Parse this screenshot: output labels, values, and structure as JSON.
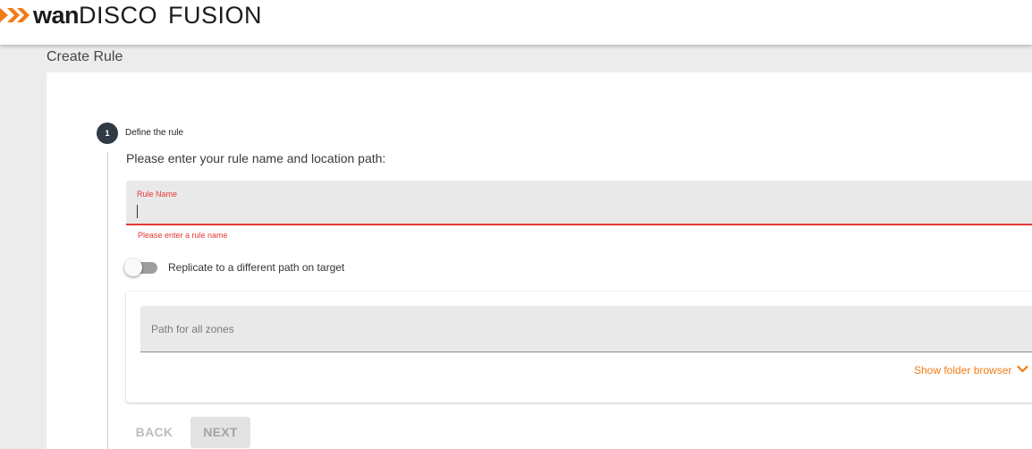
{
  "header": {
    "logo_part1": "wan",
    "logo_part2": "DISCO",
    "logo_part3": "FUSION"
  },
  "page": {
    "title": "Create Rule"
  },
  "step": {
    "number": "1",
    "title": "Define the rule",
    "instructions": "Please enter your rule name and location path:"
  },
  "rule_name": {
    "label": "Rule Name",
    "value": "",
    "error": "Please enter a rule name"
  },
  "toggle": {
    "label": "Replicate to a different path on target",
    "checked": false
  },
  "path": {
    "placeholder": "Path for all zones",
    "value": ""
  },
  "folder_browser": {
    "label": "Show folder browser"
  },
  "buttons": {
    "back": "BACK",
    "next": "NEXT"
  },
  "colors": {
    "accent": "#f07c14",
    "error": "#e53935",
    "step_badge": "#2f3a44"
  }
}
